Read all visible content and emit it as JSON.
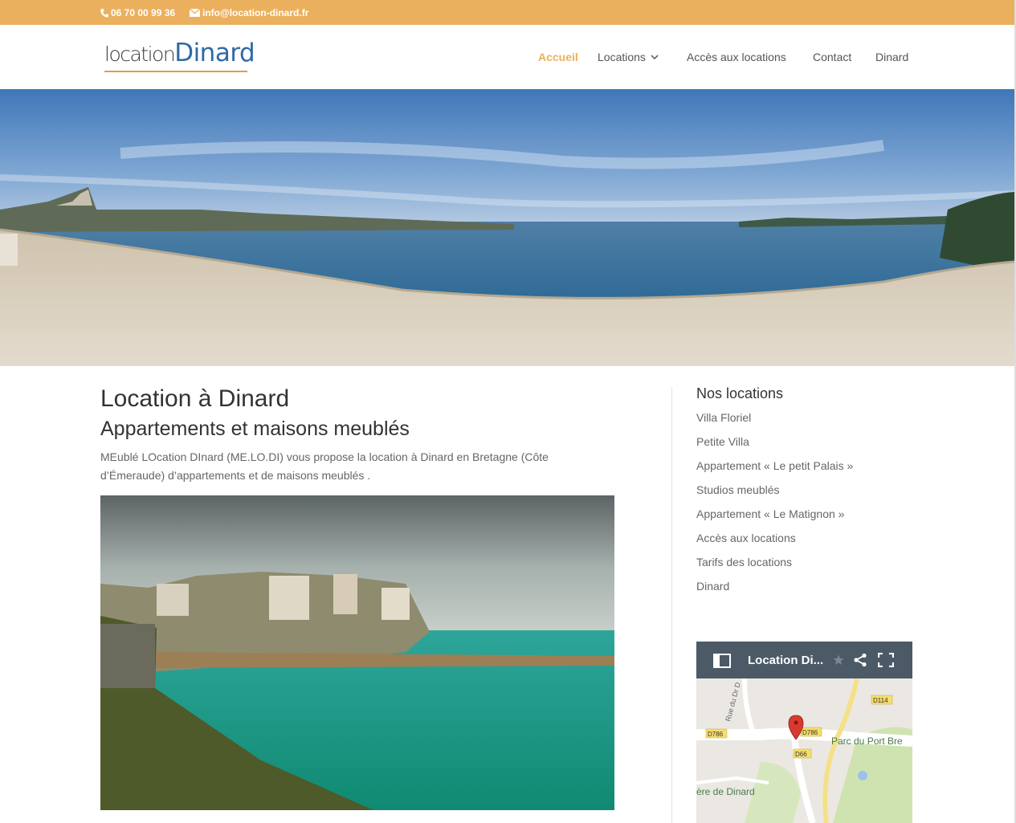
{
  "topbar": {
    "phone": "06 70 00 99 36",
    "email": "info@location-dinard.fr",
    "background": "#ebb05e"
  },
  "logo": {
    "part1": "location",
    "part2": "Dinard"
  },
  "nav": {
    "items": [
      {
        "label": "Accueil",
        "active": true
      },
      {
        "label": "Locations",
        "dropdown": true
      },
      {
        "label": "Accès aux locations"
      },
      {
        "label": "Contact"
      },
      {
        "label": "Dinard"
      }
    ],
    "accent": "#ebb05e"
  },
  "main": {
    "title": "Location à Dinard",
    "subtitle": "Appartements et maisons meublés",
    "intro": "MEublé LOcation DInard (ME.LO.DI) vous propose la location à Dinard en Bretagne (Côte d’Émeraude) d’appartements et de maisons meublés ."
  },
  "sidebar": {
    "title": "Nos locations",
    "links": [
      "Villa Floriel",
      "Petite Villa",
      "Appartement « Le petit Palais »",
      "Studios meublés",
      "Appartement « Le Matignon »",
      "Accès aux locations",
      "Tarifs des locations",
      "Dinard"
    ]
  },
  "map": {
    "title": "Location Di...",
    "labels": {
      "rue": "Rue du Dr D",
      "d786_left": "D786",
      "d786_right": "D786",
      "d114": "D114",
      "d66": "D66",
      "parc": "Parc du Port Bre",
      "dinard": "ère de Dinard"
    }
  },
  "icons": [
    "phone-icon",
    "email-icon",
    "chevron-down-icon",
    "sidebar-panel-icon",
    "star-icon",
    "share-icon",
    "fullscreen-icon",
    "map-pin-icon"
  ]
}
